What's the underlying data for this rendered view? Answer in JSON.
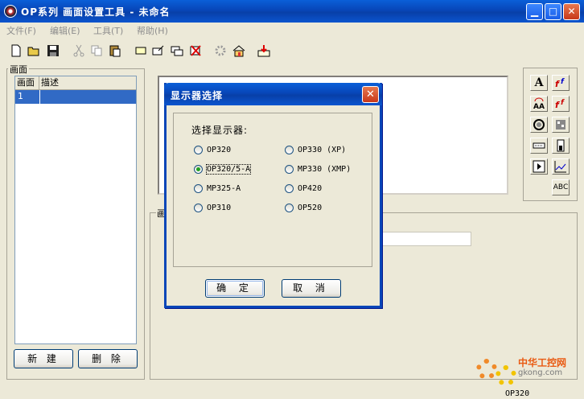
{
  "window": {
    "title": "OP系列 画面设置工具 - 未命名",
    "minimize": "▁",
    "maximize": "□",
    "close": "✕"
  },
  "menu": [
    "文件(F)",
    "编辑(E)",
    "工具(T)",
    "帮助(H)"
  ],
  "left_panel": {
    "group_label": "画面",
    "columns": [
      "画面",
      "描述"
    ],
    "rows": [
      {
        "id": "1",
        "desc": ""
      }
    ],
    "new_button": "新 建",
    "delete_button": "删 除"
  },
  "lower_panel": {
    "label": "画"
  },
  "palette": {
    "text_label": "A",
    "abc_label": "ABC"
  },
  "dialog": {
    "title": "显示器选择",
    "close": "✕",
    "prompt": "选择显示器:",
    "options": [
      {
        "label": "OP320",
        "checked": false
      },
      {
        "label": "OP330 (XP)",
        "checked": false
      },
      {
        "label": "OP320/5-A",
        "checked": true
      },
      {
        "label": "MP330 (XMP)",
        "checked": false
      },
      {
        "label": "MP325-A",
        "checked": false
      },
      {
        "label": "OP420",
        "checked": false
      },
      {
        "label": "OP310",
        "checked": false
      },
      {
        "label": "OP520",
        "checked": false
      }
    ],
    "ok_button": "确 定",
    "cancel_button": "取 消"
  },
  "status": {
    "model": "OP320"
  },
  "watermark": {
    "line1": "中华工控网",
    "line2": "gkong.com"
  },
  "colors": {
    "titlebar": "#0846b8",
    "selection": "#316ac5",
    "accent": "#e95a12"
  }
}
